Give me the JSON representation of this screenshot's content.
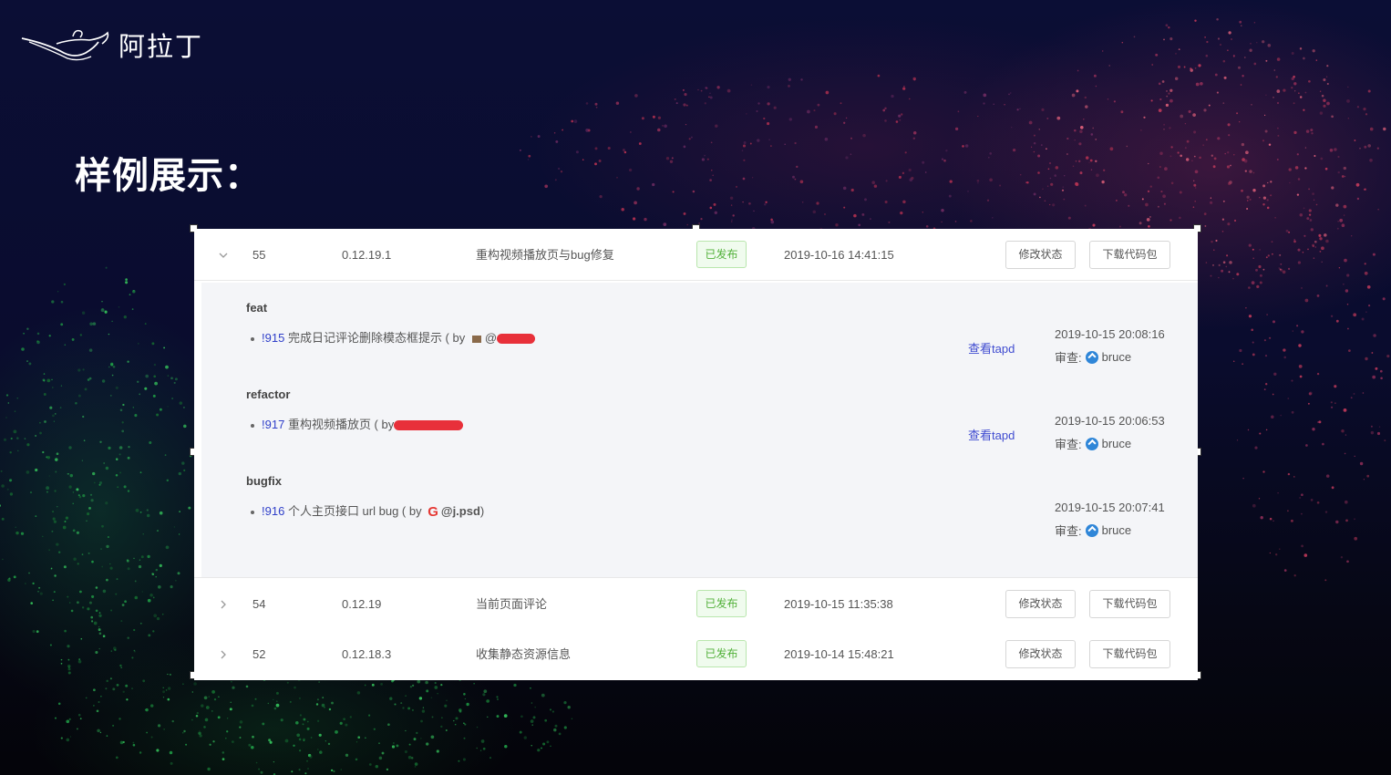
{
  "brand": {
    "name": "阿拉丁"
  },
  "slide": {
    "title": "样例展示："
  },
  "releases": [
    {
      "id": "55",
      "version": "0.12.19.1",
      "description": "重构视频播放页与bug修复",
      "status": "已发布",
      "time": "2019-10-16 14:41:15",
      "btn_status": "修改状态",
      "btn_download": "下载代码包",
      "expanded": true
    },
    {
      "id": "54",
      "version": "0.12.19",
      "description": "当前页面评论",
      "status": "已发布",
      "time": "2019-10-15 11:35:38",
      "btn_status": "修改状态",
      "btn_download": "下载代码包",
      "expanded": false
    },
    {
      "id": "52",
      "version": "0.12.18.3",
      "description": "收集静态资源信息",
      "status": "已发布",
      "time": "2019-10-14 15:48:21",
      "btn_status": "修改状态",
      "btn_download": "下载代码包",
      "expanded": false
    }
  ],
  "changes": {
    "groups": [
      {
        "label": "feat",
        "mr_id": "!915",
        "text": "完成日记评论删除模态框提示 ( by",
        "author": "@",
        "tapd": "查看tapd",
        "time": "2019-10-15 20:08:16",
        "review_label": "审查:",
        "reviewer": "bruce"
      },
      {
        "label": "refactor",
        "mr_id": "!917",
        "text": "重构视频播放页 ( by",
        "author": "",
        "tapd": "查看tapd",
        "time": "2019-10-15 20:06:53",
        "review_label": "审查:",
        "reviewer": "bruce"
      },
      {
        "label": "bugfix",
        "mr_id": "!916",
        "text": "个人主页接口 url bug ( by",
        "author": "@j.psd",
        "close": ")",
        "time": "2019-10-15 20:07:41",
        "review_label": "审查:",
        "reviewer": "bruce"
      }
    ]
  },
  "icons": {
    "brand_logo": "magic-lamp-icon",
    "expand": "chevron-down-icon",
    "collapse": "chevron-right-icon",
    "reviewer_avatar": "avatar-icon",
    "gitlab_logo": "g-logo-icon"
  },
  "colors": {
    "status_green": "#52b13a",
    "link_blue": "#2f3fc9",
    "redaction_red": "#e8303a",
    "background_navy": "#0b0e35"
  }
}
